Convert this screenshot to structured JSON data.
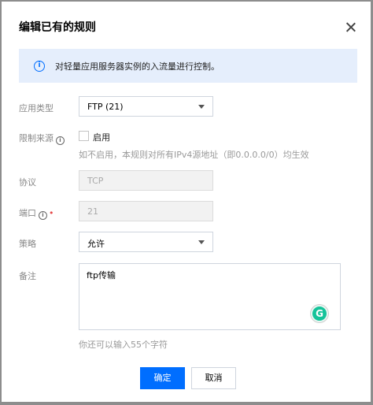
{
  "dialog": {
    "title": "编辑已有的规则",
    "notice": "对轻量应用服务器实例的入流量进行控制。"
  },
  "form": {
    "app_type": {
      "label": "应用类型",
      "value": "FTP (21)"
    },
    "source": {
      "label": "限制来源",
      "checkbox_label": "启用",
      "checked": false,
      "hint": "如不启用，本规则对所有IPv4源地址（即0.0.0.0/0）均生效"
    },
    "protocol": {
      "label": "协议",
      "value": "TCP"
    },
    "port": {
      "label": "端口",
      "value": "21"
    },
    "policy": {
      "label": "策略",
      "value": "允许"
    },
    "remark": {
      "label": "备注",
      "value": "ftp传输",
      "counter": "你还可以输入55个字符"
    }
  },
  "buttons": {
    "confirm": "确定",
    "cancel": "取消"
  },
  "colors": {
    "primary": "#006eff",
    "notice_bg": "#e5eefc",
    "required": "#e54545",
    "grammarly": "#15c39a"
  },
  "icons": {
    "notice": "info-icon",
    "close": "close-icon",
    "grammarly": "grammarly-icon"
  }
}
